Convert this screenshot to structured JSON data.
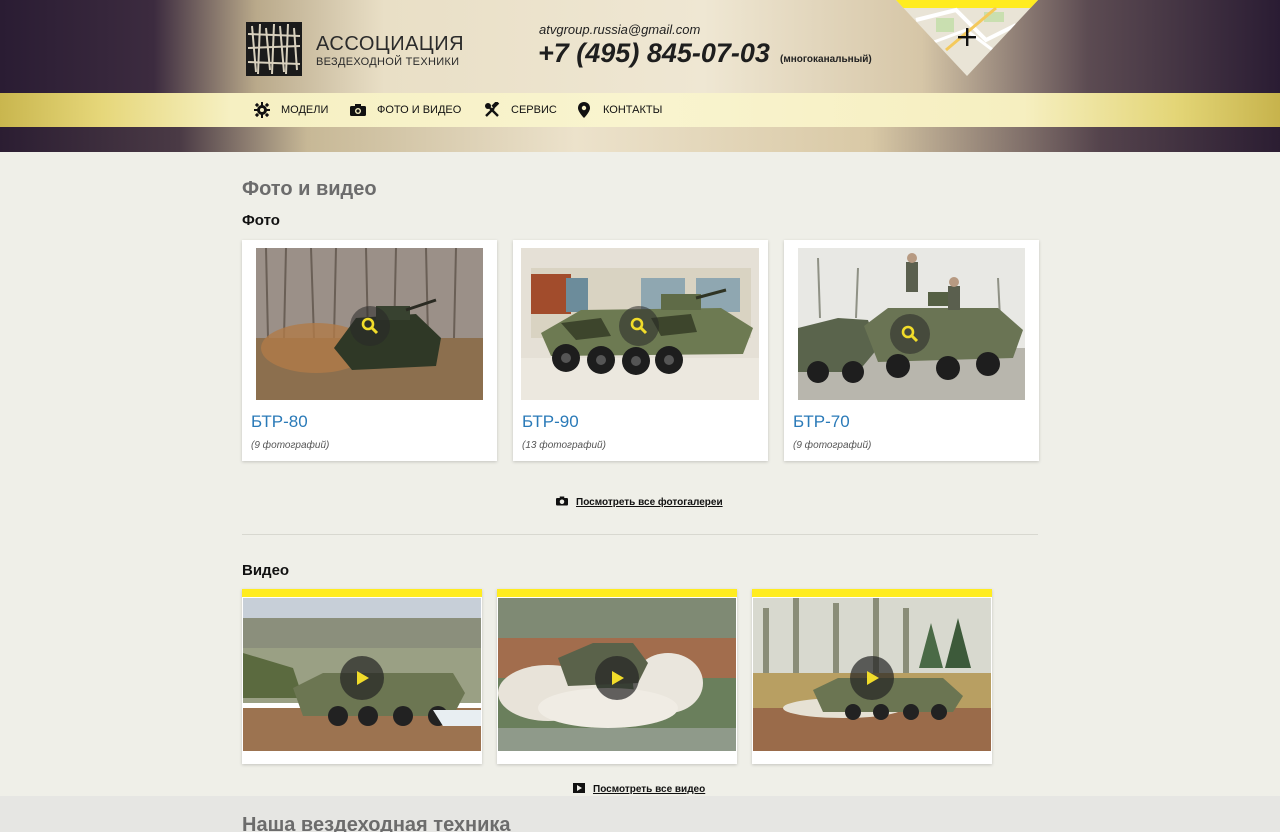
{
  "header": {
    "logo_line1": "АССОЦИАЦИЯ",
    "logo_line2": "ВЕЗДЕХОДНОЙ ТЕХНИКИ",
    "email": "atvgroup.russia@gmail.com",
    "phone": "+7 (495) 845-07-03",
    "phone_note": "(многоканальный)",
    "map_icon": "plus-icon"
  },
  "nav": {
    "items": [
      {
        "label": "МОДЕЛИ",
        "icon": "gear-icon"
      },
      {
        "label": "ФОТО И ВИДЕО",
        "icon": "camera-icon"
      },
      {
        "label": "СЕРВИС",
        "icon": "tools-icon"
      },
      {
        "label": "КОНТАКТЫ",
        "icon": "location-pin-icon"
      }
    ]
  },
  "main": {
    "page_title": "Фото и видео",
    "photo_section_title": "Фото",
    "photos": [
      {
        "title": "БТР-80",
        "count": "(9 фотографий)"
      },
      {
        "title": "БТР-90",
        "count": "(13 фотографий)"
      },
      {
        "title": "БТР-70",
        "count": "(9 фотографий)"
      }
    ],
    "all_galleries_link": "Посмотреть все фотогалереи",
    "video_section_title": "Видео",
    "videos": [
      {
        "icon": "play-icon"
      },
      {
        "icon": "play-icon"
      },
      {
        "icon": "play-icon"
      }
    ],
    "all_videos_link": "Посмотреть все видео",
    "next_section_title": "Наша вездеходная техника"
  },
  "colors": {
    "accent_yellow": "#ffec1f",
    "link_blue": "#2a7ab8",
    "dark_purple": "#2a1c33"
  }
}
